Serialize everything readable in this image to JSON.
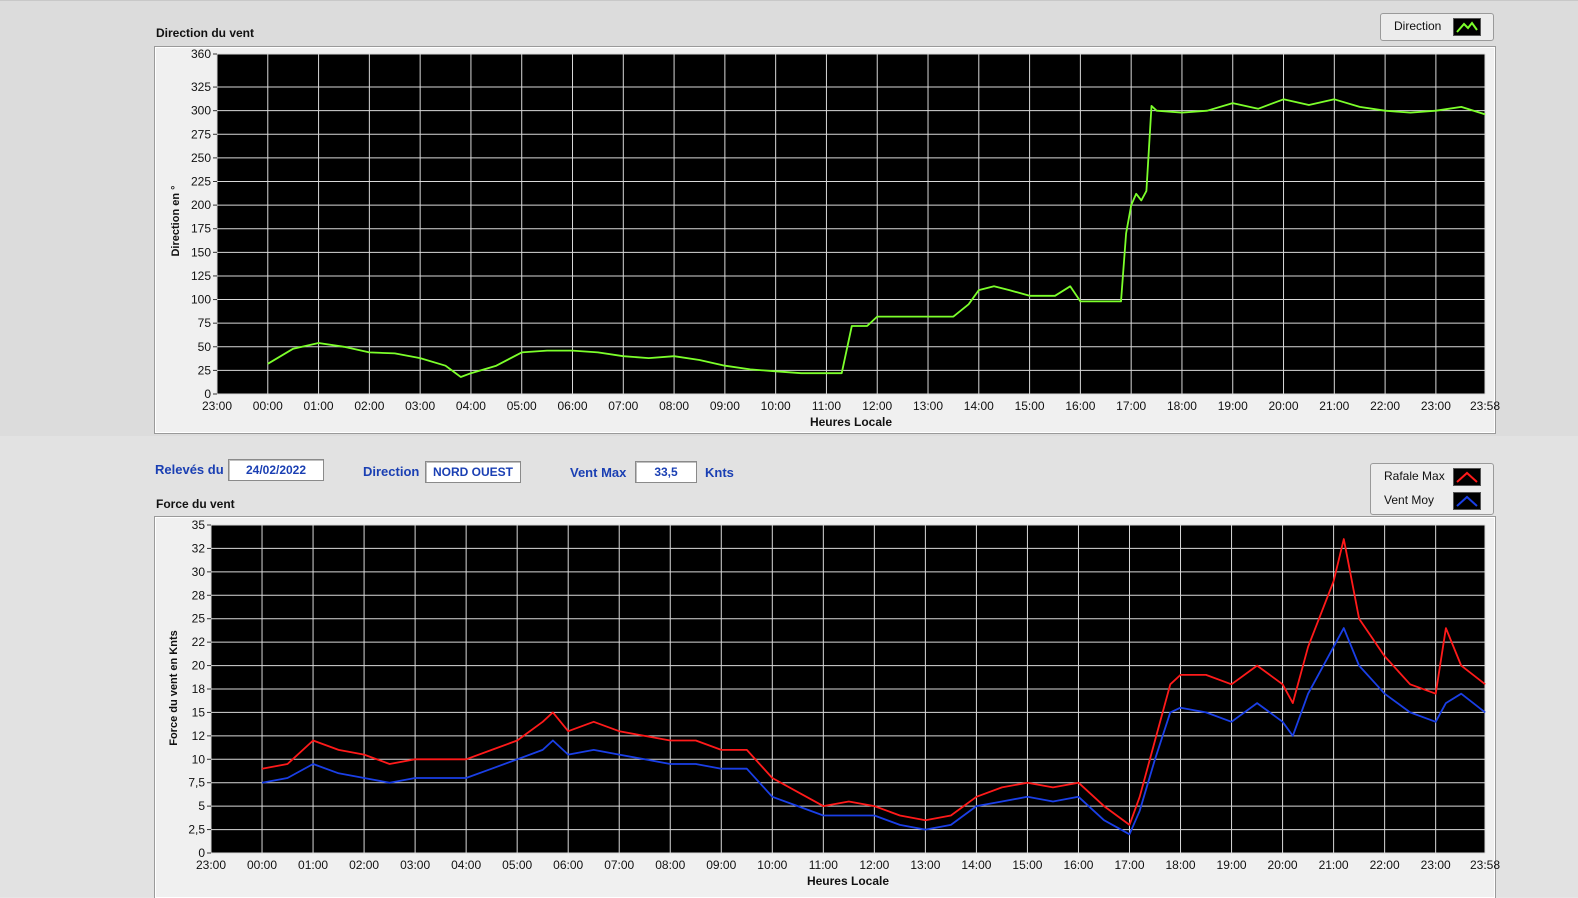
{
  "info": {
    "date_label": "Relevés du",
    "date_value": "24/02/2022",
    "direction_label": "Direction",
    "direction_value": "NORD OUEST",
    "ventmax_label": "Vent Max",
    "ventmax_value": "33,5",
    "ventmax_unit": "Knts"
  },
  "colors": {
    "direction": "#7cff2b",
    "rafale": "#ff1a1a",
    "ventmoy": "#1a3fe6",
    "plot_bg": "#000000",
    "grid": "#d9d9d9"
  },
  "chart_data": [
    {
      "type": "line",
      "title": "Direction du vent",
      "ylabel": "Direction en °",
      "xlabel": "Heures Locale",
      "ylim": [
        0,
        360
      ],
      "xlim": [
        -1,
        23.967
      ],
      "grid": true,
      "legend_position": "top-right",
      "x_ticks": [
        "23:00",
        "00:00",
        "01:00",
        "02:00",
        "03:00",
        "04:00",
        "05:00",
        "06:00",
        "07:00",
        "08:00",
        "09:00",
        "10:00",
        "11:00",
        "12:00",
        "13:00",
        "14:00",
        "15:00",
        "16:00",
        "17:00",
        "18:00",
        "19:00",
        "20:00",
        "21:00",
        "22:00",
        "23:00",
        "23:58"
      ],
      "y_ticks": [
        0,
        25,
        50,
        75,
        100,
        125,
        150,
        175,
        200,
        225,
        250,
        275,
        300,
        325,
        360
      ],
      "series": [
        {
          "name": "Direction",
          "x": [
            0,
            0.5,
            1,
            1.5,
            2,
            2.5,
            3,
            3.5,
            3.8,
            4,
            4.5,
            5,
            5.5,
            6,
            6.5,
            7,
            7.5,
            8,
            8.5,
            9,
            9.5,
            10,
            10.5,
            11,
            11.3,
            11.5,
            11.8,
            12,
            12.5,
            13,
            13.5,
            13.8,
            14,
            14.3,
            14.6,
            15,
            15.5,
            15.8,
            16,
            16.5,
            16.8,
            16.9,
            17,
            17.1,
            17.2,
            17.3,
            17.4,
            17.5,
            18,
            18.5,
            19,
            19.5,
            20,
            20.5,
            21,
            21.5,
            22,
            22.5,
            23,
            23.5,
            23.97
          ],
          "y": [
            32,
            48,
            54,
            50,
            44,
            43,
            38,
            30,
            18,
            22,
            30,
            44,
            46,
            46,
            44,
            40,
            38,
            40,
            36,
            30,
            26,
            24,
            22,
            22,
            22,
            72,
            72,
            82,
            82,
            82,
            82,
            95,
            110,
            114,
            110,
            104,
            104,
            114,
            98,
            98,
            98,
            170,
            200,
            212,
            205,
            215,
            305,
            300,
            298,
            300,
            308,
            302,
            312,
            306,
            312,
            304,
            300,
            298,
            300,
            304,
            296
          ]
        }
      ]
    },
    {
      "type": "line",
      "title": "Force du vent",
      "ylabel": "Force du vent en Knts",
      "xlabel": "Heures Locale",
      "ylim": [
        0,
        35
      ],
      "xlim": [
        -1,
        23.967
      ],
      "grid": true,
      "legend_position": "top-right",
      "x_ticks": [
        "23:00",
        "00:00",
        "01:00",
        "02:00",
        "03:00",
        "04:00",
        "05:00",
        "06:00",
        "07:00",
        "08:00",
        "09:00",
        "10:00",
        "11:00",
        "12:00",
        "13:00",
        "14:00",
        "15:00",
        "16:00",
        "17:00",
        "18:00",
        "19:00",
        "20:00",
        "21:00",
        "22:00",
        "23:00",
        "23:58"
      ],
      "y_ticks": [
        "0",
        "2,5",
        "5",
        "7,5",
        "10",
        "12",
        "15",
        "18",
        "20",
        "22",
        "25",
        "28",
        "30",
        "32",
        "35"
      ],
      "series": [
        {
          "name": "Rafale Max",
          "x": [
            0,
            0.5,
            1,
            1.5,
            2,
            2.5,
            3,
            3.5,
            4,
            4.5,
            5,
            5.5,
            5.7,
            6,
            6.5,
            7,
            7.5,
            8,
            8.5,
            9,
            9.5,
            10,
            10.5,
            11,
            11.5,
            12,
            12.5,
            13,
            13.5,
            14,
            14.5,
            15,
            15.5,
            16,
            16.5,
            17,
            17.2,
            17.5,
            17.8,
            18,
            18.5,
            19,
            19.5,
            20,
            20.2,
            20.5,
            21,
            21.2,
            21.5,
            22,
            22.5,
            23,
            23.2,
            23.5,
            23.97
          ],
          "y": [
            9,
            9.5,
            12,
            11,
            10.5,
            9.5,
            10,
            10,
            10,
            11,
            12,
            14,
            15,
            13,
            14,
            13,
            12.5,
            12,
            12,
            11,
            11,
            8,
            6.5,
            5,
            5.5,
            5,
            4,
            3.5,
            4,
            6,
            7,
            7.5,
            7,
            7.5,
            5,
            3,
            6,
            12,
            18,
            19,
            19,
            18,
            20,
            18,
            16,
            22,
            29,
            33.5,
            25,
            21,
            18,
            17,
            24,
            20,
            18
          ]
        },
        {
          "name": "Vent Moy",
          "x": [
            0,
            0.5,
            1,
            1.5,
            2,
            2.5,
            3,
            3.5,
            4,
            4.5,
            5,
            5.5,
            5.7,
            6,
            6.5,
            7,
            7.5,
            8,
            8.5,
            9,
            9.5,
            10,
            10.5,
            11,
            11.5,
            12,
            12.5,
            13,
            13.5,
            14,
            14.5,
            15,
            15.5,
            16,
            16.5,
            17,
            17.2,
            17.5,
            17.8,
            18,
            18.5,
            19,
            19.5,
            20,
            20.2,
            20.5,
            21,
            21.2,
            21.5,
            22,
            22.5,
            23,
            23.2,
            23.5,
            23.97
          ],
          "y": [
            7.5,
            8,
            9.5,
            8.5,
            8,
            7.5,
            8,
            8,
            8,
            9,
            10,
            11,
            12,
            10.5,
            11,
            10.5,
            10,
            9.5,
            9.5,
            9,
            9,
            6,
            5,
            4,
            4,
            4,
            3,
            2.5,
            3,
            5,
            5.5,
            6,
            5.5,
            6,
            3.5,
            2,
            4.5,
            10,
            15,
            15.5,
            15,
            14,
            16,
            14,
            12.5,
            17,
            22,
            24,
            20,
            17,
            15,
            14,
            16,
            17,
            15
          ]
        }
      ]
    }
  ]
}
